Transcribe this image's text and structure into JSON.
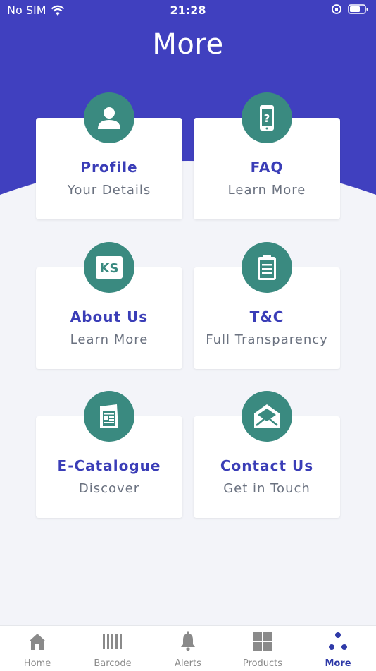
{
  "status_bar": {
    "carrier": "No SIM",
    "time": "21:28"
  },
  "header": {
    "title": "More"
  },
  "colors": {
    "brand": "#4040bf",
    "accent": "#3a8a80",
    "title_text": "#3a3db7"
  },
  "cards": [
    {
      "title": "Profile",
      "subtitle": "Your Details",
      "icon": "user-icon"
    },
    {
      "title": "FAQ",
      "subtitle": "Learn More",
      "icon": "phone-question-icon"
    },
    {
      "title": "About Us",
      "subtitle": "Learn More",
      "icon": "ks-logo-icon"
    },
    {
      "title": "T&C",
      "subtitle": "Full Transparency",
      "icon": "clipboard-icon"
    },
    {
      "title": "E-Catalogue",
      "subtitle": "Discover",
      "icon": "catalogue-icon"
    },
    {
      "title": "Contact Us",
      "subtitle": "Get in Touch",
      "icon": "envelope-icon"
    }
  ],
  "ks_logo_text": "KS",
  "tabbar": {
    "items": [
      {
        "label": "Home",
        "icon": "home-icon"
      },
      {
        "label": "Barcode",
        "icon": "barcode-icon"
      },
      {
        "label": "Alerts",
        "icon": "bell-icon"
      },
      {
        "label": "Products",
        "icon": "grid-icon"
      },
      {
        "label": "More",
        "icon": "dots-icon",
        "active": true
      }
    ]
  }
}
